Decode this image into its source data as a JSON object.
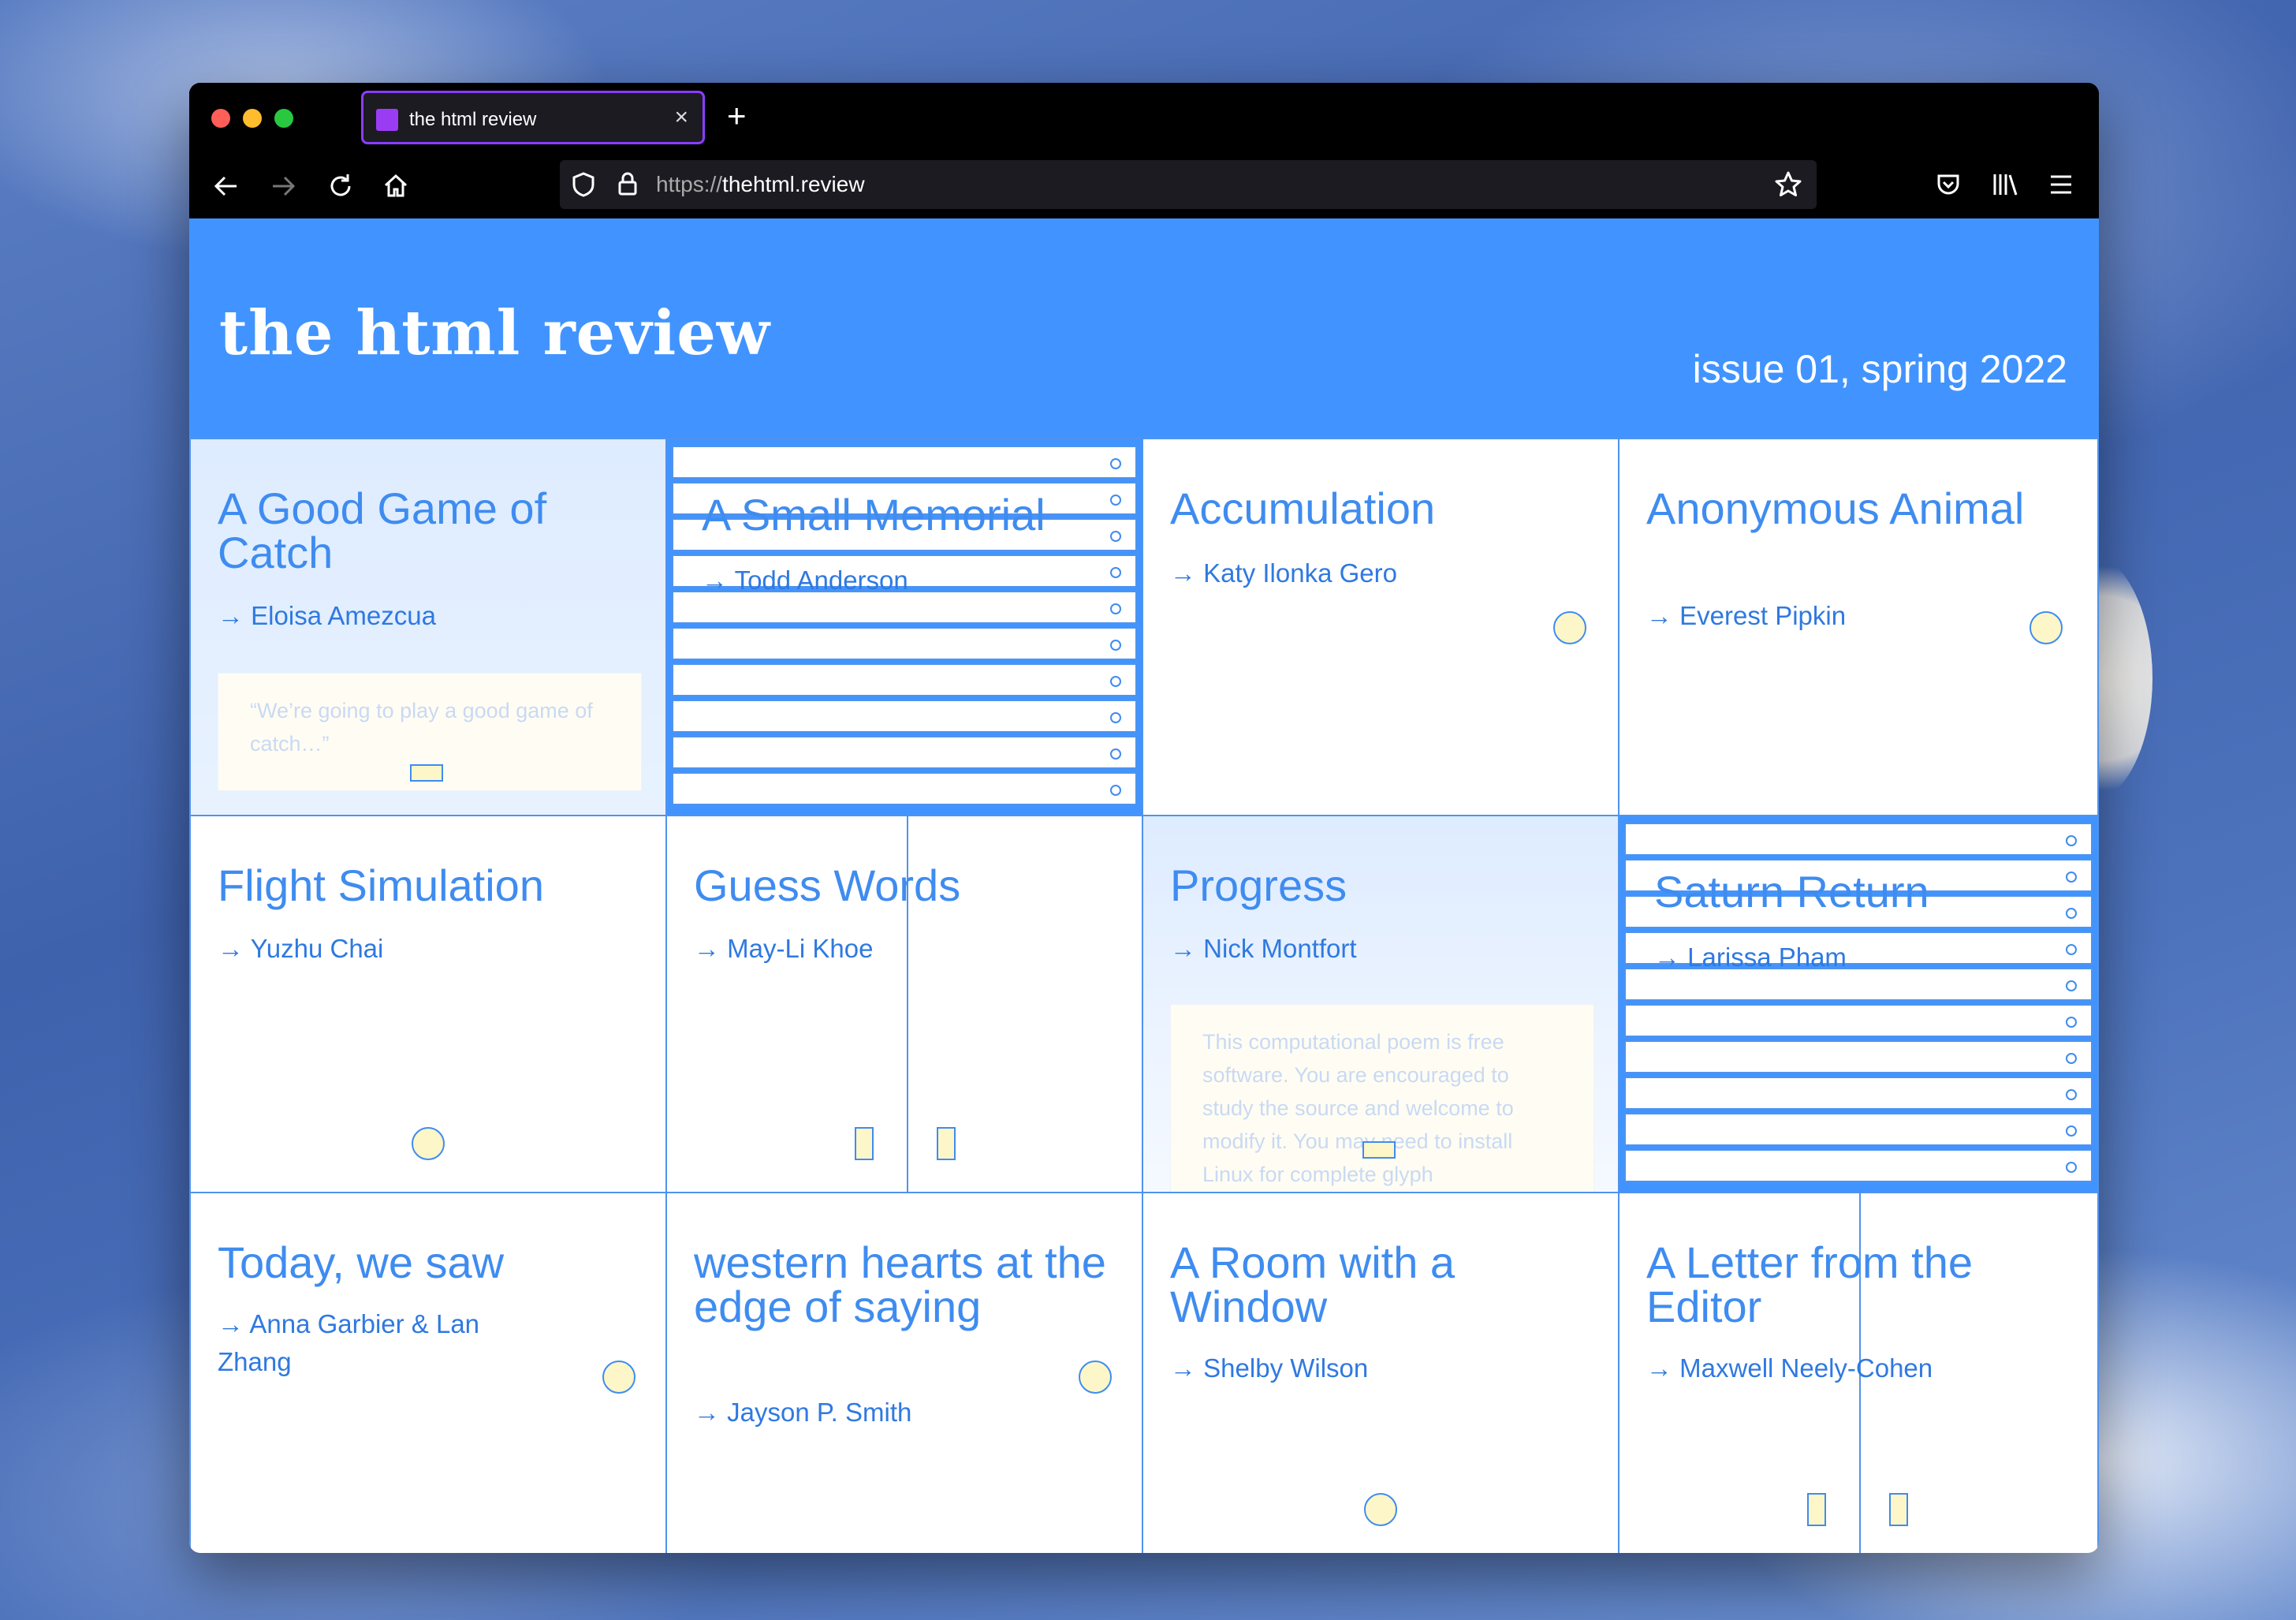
{
  "browser": {
    "tab_title": "the html review",
    "tab_close": "×",
    "new_tab": "+",
    "url_protocol": "https://",
    "url_host": "thehtml.review"
  },
  "site": {
    "title": "the html review",
    "issue": "issue 01, spring 2022"
  },
  "cards": [
    {
      "title": "A Good Game of Catch",
      "author": "→ Eloisa Amezcua",
      "excerpt": "“We’re going to play a good game of catch…”"
    },
    {
      "title": "A Small Memorial",
      "author": "→ Todd Anderson"
    },
    {
      "title": "Accumulation",
      "author": "→ Katy Ilonka Gero"
    },
    {
      "title": "Anonymous Animal",
      "author": "→ Everest Pipkin"
    },
    {
      "title": "Flight Simulation",
      "author": "→ Yuzhu Chai"
    },
    {
      "title": "Guess Words",
      "author": "→ May-Li Khoe"
    },
    {
      "title": "Progress",
      "author": "→ Nick Montfort",
      "excerpt": "This computational poem is free software. You are encouraged to study the source and welcome to modify it. You may need to install Linux for complete glyph"
    },
    {
      "title": "Saturn Return",
      "author": "→ Larissa Pham"
    },
    {
      "title": "Today, we saw",
      "author": "→ Anna Garbier & Lan Zhang"
    },
    {
      "title": "western hearts at the edge of saying",
      "author": "→ Jayson P. Smith"
    },
    {
      "title": "A Room with a Window",
      "author": "→ Shelby Wilson"
    },
    {
      "title": "A Letter from the Editor",
      "author": "→ Maxwell Neely-Cohen"
    }
  ],
  "icons": {
    "back": "back-arrow-icon",
    "forward": "forward-arrow-icon",
    "reload": "reload-icon",
    "home": "home-icon",
    "shield": "shield-icon",
    "lock": "lock-icon",
    "star": "star-icon",
    "pocket": "pocket-icon",
    "library": "library-icon",
    "menu": "hamburger-menu-icon"
  },
  "colors": {
    "accent": "#4194ff",
    "text": "#3f8cf0",
    "dot_fill": "#fdf6c8",
    "tab_border": "#8b3dff"
  }
}
